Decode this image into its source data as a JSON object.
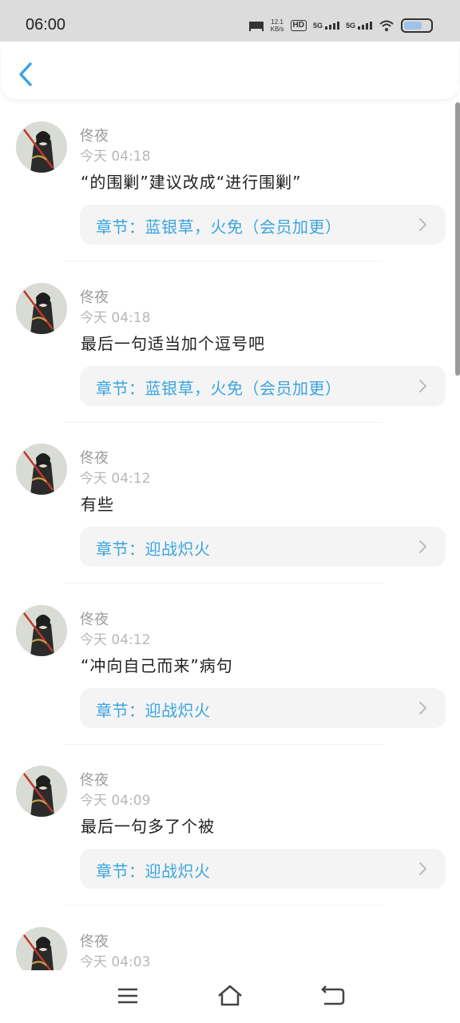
{
  "status_bar": {
    "time": "06:00",
    "speed_value": "12.1",
    "speed_unit": "KB/s",
    "hd_label": "HD",
    "network_1": "5G",
    "network_2": "5G"
  },
  "header": {
    "back_icon": "chevron-left-icon"
  },
  "comments": [
    {
      "name": "佟夜",
      "time": "今天 04:18",
      "text": "“的围剿”建议改成“进行围剿”",
      "chapter": "章节：蓝银草，火免（会员加更）"
    },
    {
      "name": "佟夜",
      "time": "今天 04:18",
      "text": "最后一句适当加个逗号吧",
      "chapter": "章节：蓝银草，火免（会员加更）"
    },
    {
      "name": "佟夜",
      "time": "今天 04:12",
      "text": "有些",
      "chapter": "章节：迎战炽火"
    },
    {
      "name": "佟夜",
      "time": "今天 04:12",
      "text": "“冲向自己而来”病句",
      "chapter": "章节：迎战炽火"
    },
    {
      "name": "佟夜",
      "time": "今天 04:09",
      "text": "最后一句多了个被",
      "chapter": "章节：迎战炽火"
    },
    {
      "name": "佟夜",
      "time": "今天 04:03",
      "text": "",
      "chapter": ""
    }
  ],
  "colors": {
    "accent": "#3aa5e0",
    "status_bar_bg": "#dcdcdc",
    "chapter_bg": "#f4f4f4"
  },
  "nav_bar": {
    "menu_icon": "menu-icon",
    "home_icon": "home-icon",
    "back_icon": "back-icon"
  }
}
